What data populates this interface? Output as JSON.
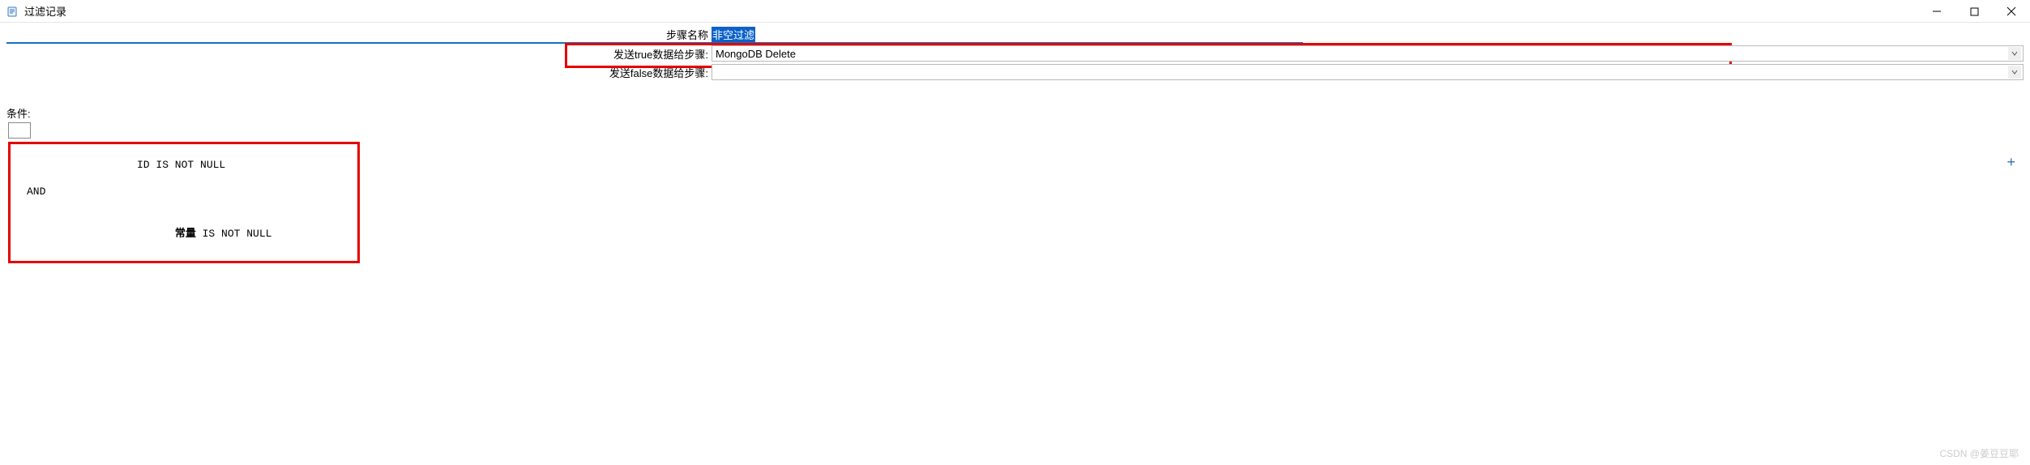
{
  "window": {
    "title": "过滤记录"
  },
  "form": {
    "step_name_label": "步骤名称",
    "step_name_value": "非空过滤",
    "send_true_label": "发送true数据给步骤:",
    "send_true_value": "MongoDB Delete",
    "send_false_label": "发送false数据给步骤:",
    "send_false_value": ""
  },
  "conditions": {
    "label": "条件:",
    "line1": "ID IS NOT NULL",
    "op": "AND",
    "line2_field": "常量",
    "line2_rest": " IS NOT NULL"
  },
  "watermark": "CSDN @姜豆豆耶"
}
